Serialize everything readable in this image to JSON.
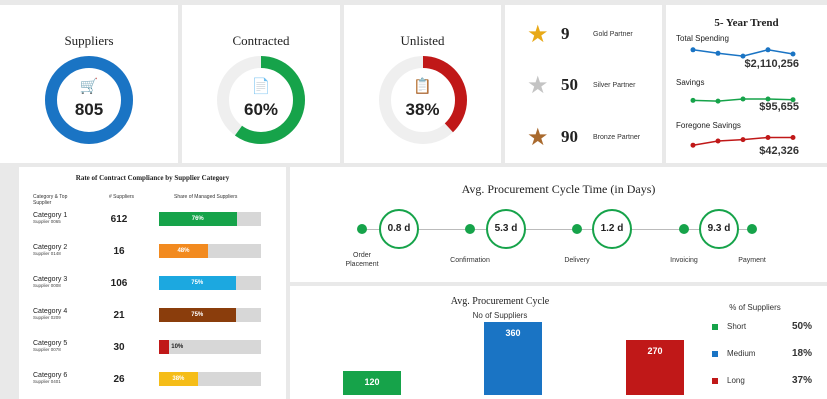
{
  "kpis": [
    {
      "title": "Suppliers",
      "value": "805",
      "color": "#1a74c4",
      "fraction": 1.0,
      "icon": "shopping-cart-icon",
      "glyph": "🛒"
    },
    {
      "title": "Contracted",
      "value": "60%",
      "color": "#16a34a",
      "fraction": 0.6,
      "icon": "contract-document-icon",
      "glyph": "📄"
    },
    {
      "title": "Unlisted",
      "value": "38%",
      "color": "#c01818",
      "fraction": 0.38,
      "icon": "clipboard-list-icon",
      "glyph": "📋"
    }
  ],
  "partners": [
    {
      "count": "9",
      "label": "Gold Partner",
      "color": "#e8a917",
      "icon": "gold-star-icon"
    },
    {
      "count": "50",
      "label": "Silver Partner",
      "color": "#c4c4c4",
      "icon": "silver-star-icon"
    },
    {
      "count": "90",
      "label": "Bronze Partner",
      "color": "#a96a2e",
      "icon": "bronze-star-icon"
    }
  ],
  "trend": {
    "title": "5- Year Trend",
    "rows": [
      {
        "label": "Total Spending",
        "value": "$2,110,256",
        "color": "#1a74c4",
        "points": [
          0.8,
          0.55,
          0.35,
          0.8,
          0.5
        ]
      },
      {
        "label": "Savings",
        "value": "$95,655",
        "color": "#16a34a",
        "points": [
          0.4,
          0.35,
          0.5,
          0.5,
          0.45
        ]
      },
      {
        "label": "Foregone Savings",
        "value": "$42,326",
        "color": "#c01818",
        "points": [
          0.2,
          0.5,
          0.6,
          0.75,
          0.75
        ]
      }
    ]
  },
  "compliance": {
    "title": "Rate of Contract Compliance by Supplier Category",
    "headers": {
      "category": "Category & Top Supplier",
      "suppliers": "# Suppliers",
      "share": "Share of Managed Suppliers"
    },
    "rows": [
      {
        "category": "Category 1",
        "supplier": "Supplier 0065",
        "count": "612",
        "pct": 76,
        "pct_label": "76%",
        "color": "#16a34a"
      },
      {
        "category": "Category 2",
        "supplier": "Supplier 0148",
        "count": "16",
        "pct": 48,
        "pct_label": "48%",
        "color": "#f28a1f"
      },
      {
        "category": "Category 3",
        "supplier": "Supplier 0008",
        "count": "106",
        "pct": 75,
        "pct_label": "75%",
        "color": "#1ca8e0"
      },
      {
        "category": "Category 4",
        "supplier": "Supplier 0209",
        "count": "21",
        "pct": 75,
        "pct_label": "75%",
        "color": "#8a3d0c"
      },
      {
        "category": "Category 5",
        "supplier": "Supplier 0078",
        "count": "30",
        "pct": 10,
        "pct_label": "10%",
        "color": "#c01818"
      },
      {
        "category": "Category 6",
        "supplier": "Supplier 0401",
        "count": "26",
        "pct": 38,
        "pct_label": "38%",
        "color": "#f5bd18"
      }
    ]
  },
  "cycle_time": {
    "title": "Avg. Procurement Cycle Time (in Days)",
    "steps": [
      "Order Placement",
      "Confirmation",
      "Delivery",
      "Invoicing",
      "Payment"
    ],
    "durations": [
      "0.8 d",
      "5.3 d",
      "1.2 d",
      "9.3 d"
    ]
  },
  "chart_data": {
    "type": "bar",
    "title": "Avg. Procurement Cycle",
    "ylabel": "No of Suppliers",
    "categories": [
      "Short",
      "Medium",
      "Long"
    ],
    "values": [
      120,
      360,
      270
    ],
    "colors": [
      "#16a34a",
      "#1a74c4",
      "#c01818"
    ],
    "legend_title": "% of Suppliers",
    "legend_percents": [
      "50%",
      "18%",
      "37%"
    ]
  }
}
